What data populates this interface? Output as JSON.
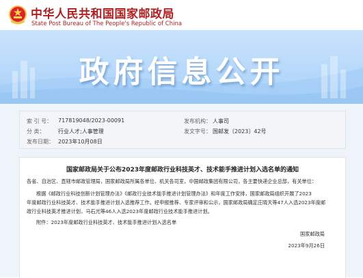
{
  "site": {
    "name_cn": "中华人民共和国国家邮政局",
    "name_en": "State Post Bureau of The People's Republic of China",
    "logo_icon": "national-emblem-icon",
    "brand_color": "#b01f20"
  },
  "banner": {
    "title": "政府信息公开"
  },
  "meta": {
    "index_label": "索  引  号：",
    "index_value": "717819048/2023-00091",
    "agency_label": "发布机构：",
    "agency_value": "人事司",
    "category_label": "分      类：",
    "category_value": "行业人才;人事管理",
    "docno_label": "发文字号：",
    "docno_value": "国邮发〔2023〕42号",
    "date_label": "发布日期：",
    "date_value": "2023年10月08日"
  },
  "article": {
    "title": "国家邮政局关于公布2023年度邮政行业科技英才、技术能手推进计划入选名单的通知",
    "recipients": "各省、自治区、直辖市邮政管理局，国家邮政局所属各单位、机关各司室，中国邮政集团有限公司，各主要快递企业总部，有关单位：",
    "body_line1": "根据《邮政行业科技创新计划管理办法》《邮政行业技术能手推进计划管理办法》和年度工作安排，国家邮政局组织开展了2023",
    "body_line2": "年度邮政行业科技英才、技术能手推进计划入选推荐工作。经申报推荐、专家评审和公示，国家邮政局确定庄晓天等47人入选2023年度邮",
    "body_line3": "政行业科技英才推进计划，马石光等46人入选2023年度邮政行业技术能手推进计划。",
    "attachment": "附件：2023年度邮政行业科技英才、技术能手推进计划入选名单",
    "signature": "国家邮政局",
    "sign_date": "2023年9月26日"
  }
}
